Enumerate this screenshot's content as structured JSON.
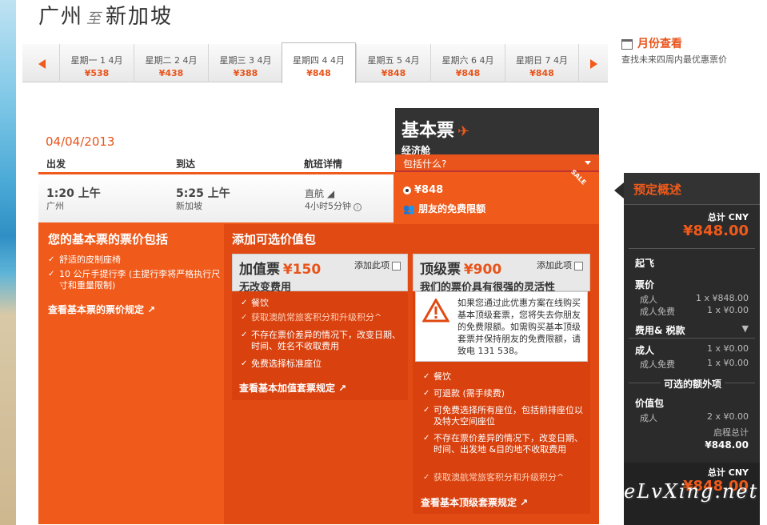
{
  "route": {
    "origin": "广州",
    "connector": "至",
    "destination": "新加坡"
  },
  "date_tabs": [
    {
      "day": "星期一 1 4月",
      "price": "¥538"
    },
    {
      "day": "星期二 2 4月",
      "price": "¥438"
    },
    {
      "day": "星期三 3 4月",
      "price": "¥388"
    },
    {
      "day": "星期四 4 4月",
      "price": "¥848"
    },
    {
      "day": "星期五 5 4月",
      "price": "¥848"
    },
    {
      "day": "星期六 6 4月",
      "price": "¥848"
    },
    {
      "day": "星期日 7 4月",
      "price": "¥848"
    }
  ],
  "monthly": {
    "label": "月份查看",
    "sub": "查找未来四周内最优惠票价"
  },
  "flight": {
    "date": "04/04/2013",
    "headers": {
      "depart": "出发",
      "arrive": "到达",
      "details": "航班详情"
    },
    "depart_time": "1:20 上午",
    "depart_city": "广州",
    "arrive_time": "5:25 上午",
    "arrive_city": "新加坡",
    "type": "直航",
    "duration": "4小时5分钟"
  },
  "fare": {
    "name": "基本票",
    "cabin": "经济舱",
    "what_included": "包括什么?",
    "price": "¥848",
    "free_allowance": "朋友的免费限额",
    "sale": "SALE"
  },
  "basic_includes": {
    "title": "您的基本票的票价包括",
    "items": [
      "舒适的皮制座椅",
      "10 公斤手提行李 (主提行李将严格执行尺寸和重量限制)"
    ],
    "link": "查看基本票的票价规定 ↗"
  },
  "addon": {
    "title": "添加可选价值包",
    "plus": {
      "name": "加值票",
      "price": "¥150",
      "subtitle": "无改变费用",
      "add_label": "添加此项",
      "items": [
        "餐饮",
        "获取澳航常旅客积分和升级积分^",
        "不存在票价差异的情况下，改变日期、时间、姓名不收取费用",
        "免费选择标准座位"
      ],
      "link": "查看基本加值套票规定 ↗"
    },
    "max": {
      "name": "顶级票",
      "price": "¥900",
      "subtitle": "我们的票价具有很强的灵活性",
      "add_label": "添加此项",
      "warning": "如果您通过此优惠方案在线购买基本顶级套票，您将失去你朋友的免费限额。如需购买基本顶级套票并保持朋友的免费限额，请致电 131 538。",
      "items": [
        "餐饮",
        "可退款 (需手续费)",
        "可免费选择所有座位，包括前排座位以及特大空间座位",
        "不存在票价差异的情况下，改变日期、时间、出发地 &目的地不收取费用",
        "获取澳航常旅客积分和升级积分^"
      ],
      "link": "查看基本顶级套票规定 ↗"
    }
  },
  "summary": {
    "title": "预定概述",
    "total_label": "总计 CNY",
    "total": "¥848.00",
    "depart": "起飞",
    "fare_label": "票价",
    "adult": "成人",
    "adult_val": "1 x ¥848.00",
    "infant": "成人免费",
    "infant_val": "1 x ¥0.00",
    "fees_label": "费用& 税款",
    "fees_adult": "成人",
    "fees_adult_val": "1 x ¥0.00",
    "fees_infant": "成人免费",
    "fees_infant_val": "1 x ¥0.00",
    "extras_label": "可选的额外项",
    "bundle_label": "价值包",
    "bundle_adult": "成人",
    "bundle_adult_val": "2 x ¥0.00",
    "subtotal_label": "启程总计",
    "subtotal": "¥848.00",
    "total_label2": "总计 CNY",
    "total2": "¥848.00"
  },
  "watermark": "eLvXing.net",
  "colors": {
    "accent": "#f05a1a",
    "dark": "#2b2b2b"
  }
}
